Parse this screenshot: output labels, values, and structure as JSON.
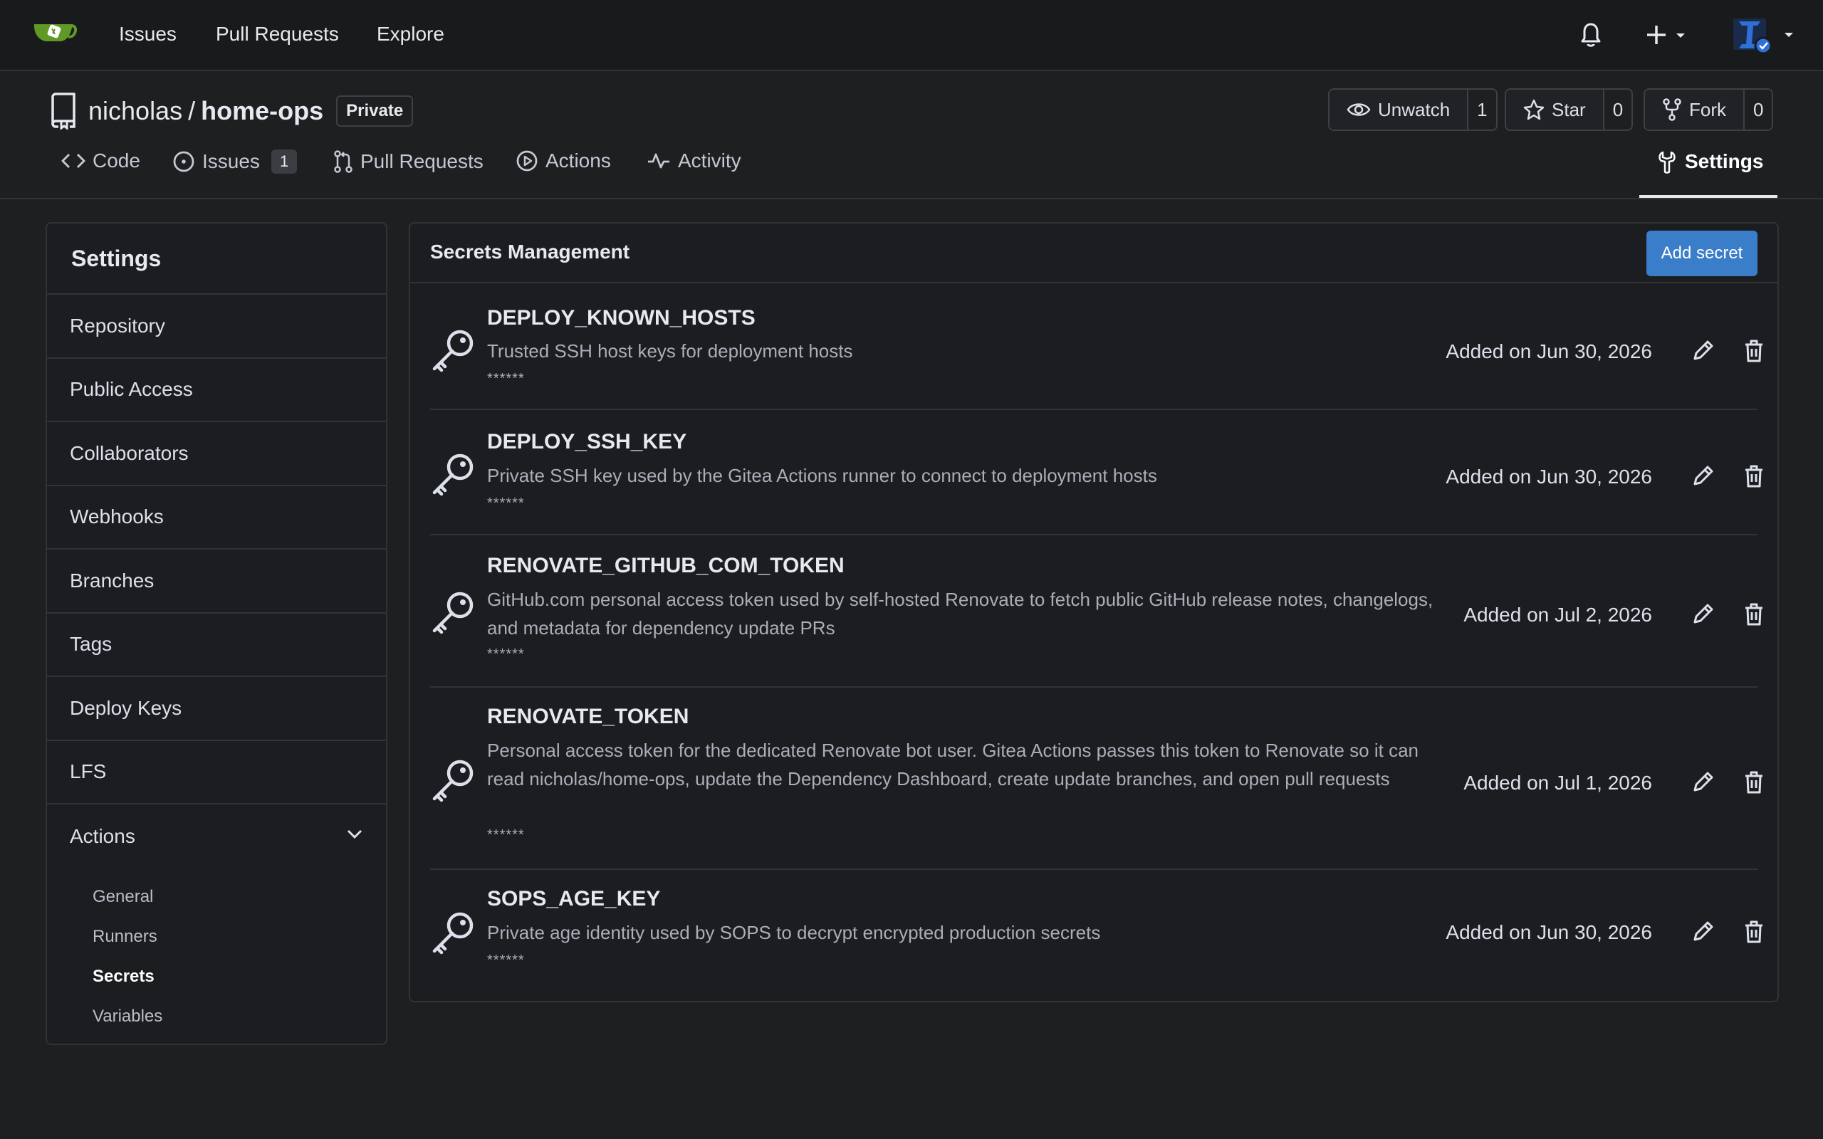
{
  "navbar": {
    "links": [
      "Issues",
      "Pull Requests",
      "Explore"
    ],
    "icons": [
      "gitea-logo",
      "bell-icon",
      "plus-icon",
      "user-avatar"
    ]
  },
  "repo": {
    "owner": "nicholas",
    "separator": "/",
    "name": "home-ops",
    "visibility": "Private",
    "watch": {
      "label": "Unwatch",
      "count": "1"
    },
    "star": {
      "label": "Star",
      "count": "0"
    },
    "fork": {
      "label": "Fork",
      "count": "0"
    }
  },
  "tabs": [
    {
      "label": "Code"
    },
    {
      "label": "Issues",
      "count": "1"
    },
    {
      "label": "Pull Requests"
    },
    {
      "label": "Actions"
    },
    {
      "label": "Activity"
    },
    {
      "label": "Settings",
      "active": true
    }
  ],
  "sidebar": {
    "title": "Settings",
    "items": [
      "Repository",
      "Public Access",
      "Collaborators",
      "Webhooks",
      "Branches",
      "Tags",
      "Deploy Keys",
      "LFS",
      "Actions"
    ],
    "actions_sub": [
      "General",
      "Runners",
      "Secrets",
      "Variables"
    ],
    "active_sub": "Secrets"
  },
  "panel": {
    "title": "Secrets Management",
    "add_button": "Add secret"
  },
  "secrets": [
    {
      "name": "DEPLOY_KNOWN_HOSTS",
      "description": "Trusted SSH host keys for deployment hosts",
      "mask": "******",
      "date": "Added on Jun 30, 2026"
    },
    {
      "name": "DEPLOY_SSH_KEY",
      "description": "Private SSH key used by the Gitea Actions runner to connect to deployment hosts",
      "mask": "******",
      "date": "Added on Jun 30, 2026"
    },
    {
      "name": "RENOVATE_GITHUB_COM_TOKEN",
      "description": "GitHub.com personal access token used by self-hosted Renovate to fetch public GitHub release notes, changelogs, and metadata for dependency update PRs",
      "mask": "******",
      "date": "Added on Jul 2, 2026"
    },
    {
      "name": "RENOVATE_TOKEN",
      "description": "Personal access token for the dedicated Renovate bot user. Gitea Actions passes this token to Renovate so it can read nicholas/home-ops, update the Dependency Dashboard, create update branches, and open pull requests",
      "mask": "******",
      "date": "Added on Jul 1, 2026"
    },
    {
      "name": "SOPS_AGE_KEY",
      "description": "Private age identity used by SOPS to decrypt encrypted production secrets",
      "mask": "******",
      "date": "Added on Jun 30, 2026"
    }
  ],
  "colors": {
    "background": "#1d1f21",
    "navbar": "#181a1c",
    "accent": "#3a7dc9",
    "logo": "#609926",
    "avatar": "#2f6fd6"
  }
}
